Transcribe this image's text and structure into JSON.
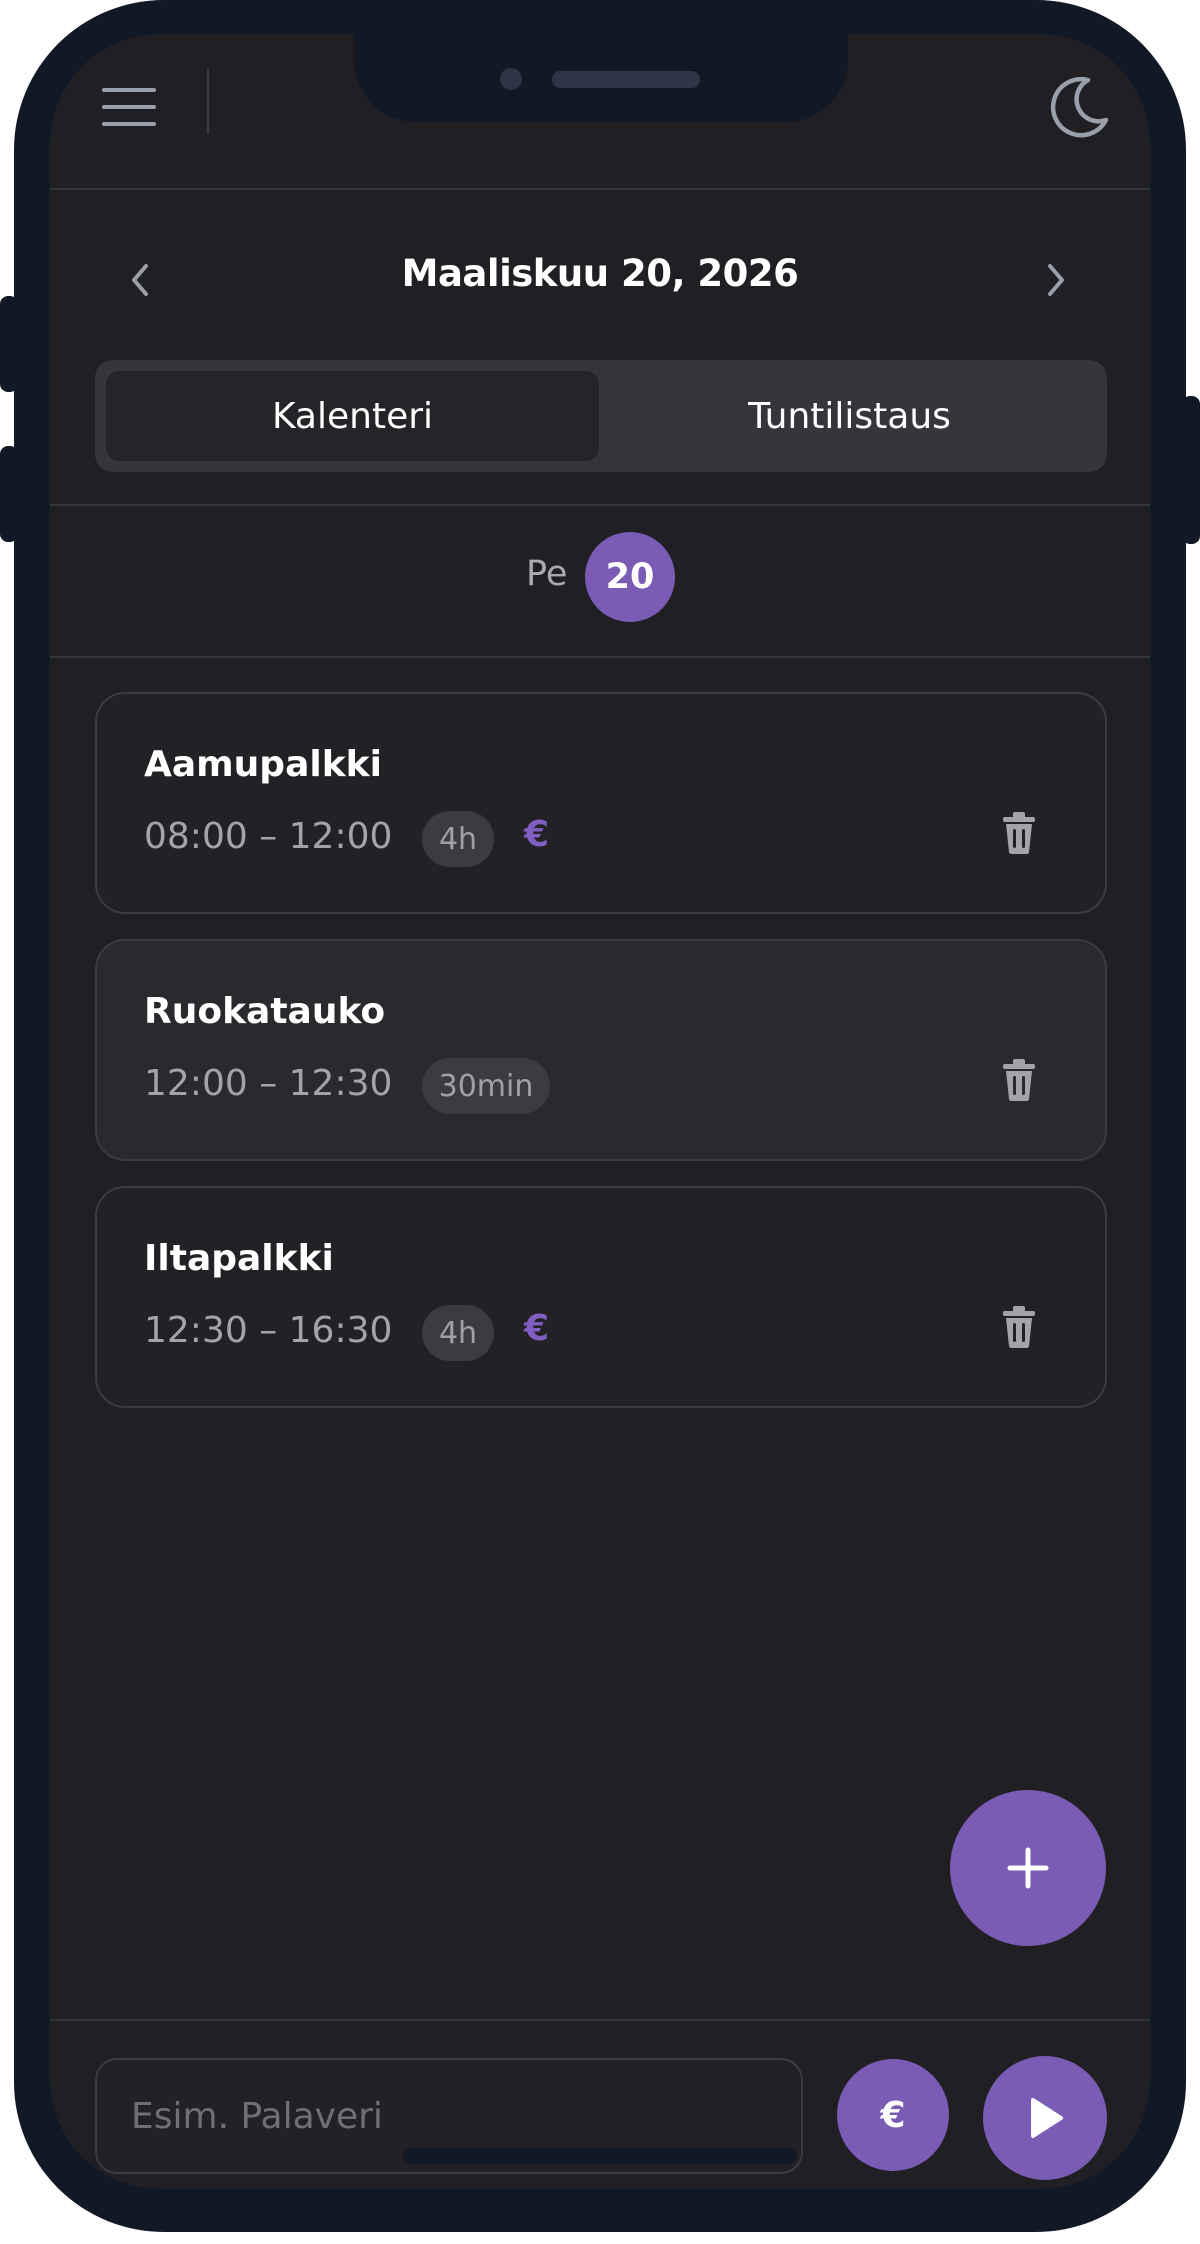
{
  "header": {
    "menu_icon": "hamburger-menu-icon",
    "theme_icon": "moon-icon"
  },
  "date_nav": {
    "title": "Maaliskuu 20, 2026",
    "prev_icon": "chevron-left-icon",
    "next_icon": "chevron-right-icon"
  },
  "tabs": [
    {
      "label": "Kalenteri",
      "active": true
    },
    {
      "label": "Tuntilistaus",
      "active": false
    }
  ],
  "day": {
    "weekday": "Pe",
    "date": "20"
  },
  "entries": [
    {
      "title": "Aamupalkki",
      "time": "08:00 – 12:00",
      "duration": "4h",
      "billable": true,
      "billable_symbol": "€"
    },
    {
      "title": "Ruokatauko",
      "time": "12:00 – 12:30",
      "duration": "30min",
      "billable": false
    },
    {
      "title": "Iltapalkki",
      "time": "12:30 – 16:30",
      "duration": "4h",
      "billable": true,
      "billable_symbol": "€"
    }
  ],
  "bottom_bar": {
    "input_placeholder": "Esim. Palaveri",
    "input_value": "",
    "euro_label": "€",
    "play_icon": "play-icon",
    "add_icon": "plus-icon"
  },
  "colors": {
    "accent": "#7a5cb5",
    "background": "#1f1f24",
    "card": "#222226",
    "frame": "#111927"
  }
}
